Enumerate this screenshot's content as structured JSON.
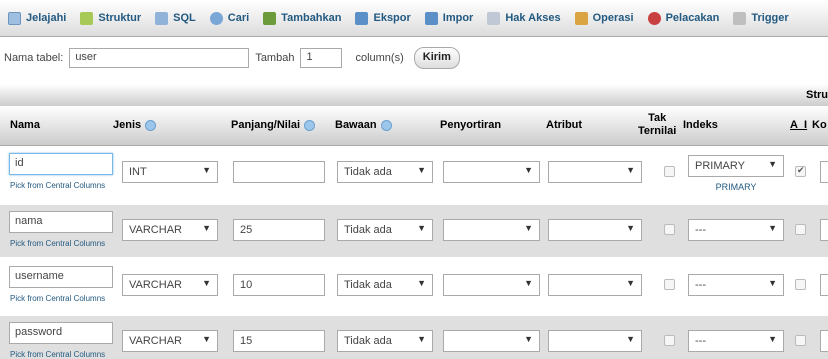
{
  "tabs": [
    {
      "label": "Jelajahi",
      "icon": "browse-icon",
      "color": "#9fbfe0"
    },
    {
      "label": "Struktur",
      "icon": "structure-icon",
      "color": "#a7c957"
    },
    {
      "label": "SQL",
      "icon": "sql-icon",
      "color": "#8fb3d9"
    },
    {
      "label": "Cari",
      "icon": "search-icon",
      "color": "#7aa7d6"
    },
    {
      "label": "Tambahkan",
      "icon": "insert-icon",
      "color": "#6b9b3a"
    },
    {
      "label": "Ekspor",
      "icon": "export-icon",
      "color": "#5b8fc7"
    },
    {
      "label": "Impor",
      "icon": "import-icon",
      "color": "#5b8fc7"
    },
    {
      "label": "Hak Akses",
      "icon": "privileges-icon",
      "color": "#c0c8d6"
    },
    {
      "label": "Operasi",
      "icon": "operations-icon",
      "color": "#d9a441"
    },
    {
      "label": "Pelacakan",
      "icon": "tracking-icon",
      "color": "#c94040"
    },
    {
      "label": "Trigger",
      "icon": "trigger-icon",
      "color": "#bfbfbf"
    }
  ],
  "table_form": {
    "name_label": "Nama tabel:",
    "name_value": "user",
    "add_label": "Tambah",
    "add_value": "1",
    "columns_label": "column(s)",
    "submit_label": "Kirim"
  },
  "structure_label": "Stru",
  "headers": {
    "nama": "Nama",
    "jenis": "Jenis",
    "panjang": "Panjang/Nilai",
    "bawaan": "Bawaan",
    "penyortiran": "Penyortiran",
    "atribut": "Atribut",
    "tak_ternilai_1": "Tak",
    "tak_ternilai_2": "Ternilai",
    "indeks": "Indeks",
    "ai": "A_I",
    "komentar": "Ko"
  },
  "pick_label": "Pick from Central Columns",
  "rows": [
    {
      "name": "id",
      "type": "INT",
      "length": "",
      "default": "Tidak ada",
      "collation": "",
      "attribute": "",
      "null": false,
      "index": "PRIMARY",
      "index_sub": "PRIMARY",
      "ai": true
    },
    {
      "name": "nama",
      "type": "VARCHAR",
      "length": "25",
      "default": "Tidak ada",
      "collation": "",
      "attribute": "",
      "null": false,
      "index": "---",
      "index_sub": "",
      "ai": false
    },
    {
      "name": "username",
      "type": "VARCHAR",
      "length": "10",
      "default": "Tidak ada",
      "collation": "",
      "attribute": "",
      "null": false,
      "index": "---",
      "index_sub": "",
      "ai": false
    },
    {
      "name": "password",
      "type": "VARCHAR",
      "length": "15",
      "default": "Tidak ada",
      "collation": "",
      "attribute": "",
      "null": false,
      "index": "---",
      "index_sub": "",
      "ai": false
    }
  ],
  "colors": {
    "link": "#235a81",
    "row_alt": "#dfdfdf"
  }
}
